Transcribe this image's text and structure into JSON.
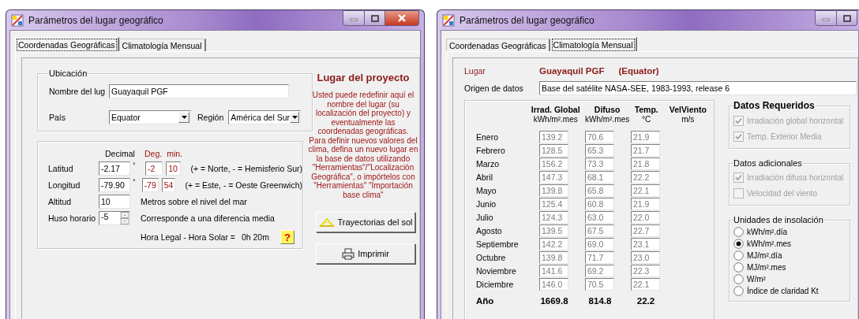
{
  "windows": [
    {
      "kind": "coordinates",
      "title": "Parámetros del lugar geográfico",
      "tabs": [
        {
          "label": "Coordenadas Geográficas",
          "selected": true
        },
        {
          "label": "Climatología Mensual",
          "selected": false
        }
      ],
      "location": {
        "legend": "Ubicación",
        "name_label": "Nombre del lug",
        "name_value": "Guayaquil PGF",
        "country_label": "País",
        "country_value": "Equator",
        "region_label": "Región",
        "region_value": "América del Sur"
      },
      "coordinates": {
        "headers": {
          "decimal": "Decimal",
          "degrees": "Deg.",
          "minutes": "min."
        },
        "rows": [
          {
            "label": "Latitud",
            "decimal": "-2.17",
            "unit": "°",
            "degrees": "-2",
            "minutes": "10",
            "note": "(+ = Norte, - = Hemisferio Sur)"
          },
          {
            "label": "Longitud",
            "decimal": "-79.90",
            "unit": "°",
            "degrees": "-79",
            "minutes": "54",
            "note": "(+ = Este, - = Oeste Greenwich)"
          }
        ],
        "altitude": {
          "label": "Altitud",
          "value": "10",
          "note": "Metros sobre el nivel del mar"
        },
        "timezone": {
          "label": "Huso horario",
          "value": "-5",
          "note": "Corresponde a una diferencia media"
        },
        "time_difference": {
          "label": "Hora Legal - Hora Solar =",
          "value": "0h 20m"
        },
        "help_button": "?"
      },
      "info": {
        "title": "Lugar del proyecto",
        "paragraphs": [
          "Usted puede redefinir aquí el nombre del lugar (su localización del proyecto) y eventualmente las coordenadas geográficas.",
          "Para definir nuevos valores del clima, defina un nuevo lugar en la base de datos utilizando \"Herramientas\"/\"Localización Geográfica\", o impórtelos con \"Herramientas\" \"Importación base clima\""
        ]
      },
      "buttons": [
        {
          "label": "Trayectorias del sol"
        },
        {
          "label": "Imprimir"
        }
      ]
    },
    {
      "kind": "climate",
      "title": "Parámetros del lugar geográfico",
      "tabs": [
        {
          "label": "Coordenadas Geográficas",
          "selected": false
        },
        {
          "label": "Climatología Mensual",
          "selected": true
        }
      ],
      "place": {
        "label": "Lugar",
        "name": "Guayaquil PGF",
        "country": "(Equator)"
      },
      "source": {
        "label": "Origen de datos",
        "value": "Base del satélite NASA-SEE,  1983-1993, release 6"
      },
      "table": {
        "columns": [
          {
            "title": "Irrad. Global",
            "unit": "kWh/m².mes"
          },
          {
            "title": "Difuso",
            "unit": "kWh/m².mes"
          },
          {
            "title": "Temp.",
            "unit": "°C"
          },
          {
            "title": "VelViento",
            "unit": "m/s"
          }
        ],
        "rows": [
          {
            "month": "Enero",
            "values": [
              "139.2",
              "70.6",
              "21.9"
            ]
          },
          {
            "month": "Febrero",
            "values": [
              "128.5",
              "65.3",
              "21.7"
            ]
          },
          {
            "month": "Marzo",
            "values": [
              "156.2",
              "73.3",
              "21.8"
            ]
          },
          {
            "month": "Abril",
            "values": [
              "147.3",
              "68.1",
              "22.2"
            ]
          },
          {
            "month": "Mayo",
            "values": [
              "139.8",
              "65.8",
              "22.1"
            ]
          },
          {
            "month": "Junio",
            "values": [
              "125.4",
              "60.8",
              "21.9"
            ]
          },
          {
            "month": "Julio",
            "values": [
              "124.3",
              "63.0",
              "22.0"
            ]
          },
          {
            "month": "Agosto",
            "values": [
              "139.5",
              "67.5",
              "22.7"
            ]
          },
          {
            "month": "Septiembre",
            "values": [
              "142.2",
              "69.0",
              "23.1"
            ]
          },
          {
            "month": "Octubre",
            "values": [
              "139.8",
              "71.7",
              "23.0"
            ]
          },
          {
            "month": "Noviembre",
            "values": [
              "141.6",
              "69.2",
              "22.3"
            ]
          },
          {
            "month": "Diciembre",
            "values": [
              "146.0",
              "70.5",
              "22.1"
            ]
          }
        ],
        "total": {
          "label": "Año",
          "values": [
            "1669.8",
            "814.8",
            "22.2"
          ]
        }
      },
      "groups": [
        {
          "title": "Datos Requeridos",
          "kind": "checkbox",
          "items": [
            {
              "label": "Irradiación global horizontal",
              "checked": true,
              "disabled": true
            },
            {
              "label": "Temp. Exterior Media",
              "checked": true,
              "disabled": true
            }
          ]
        },
        {
          "title": "Datos adicionales",
          "kind": "checkbox",
          "items": [
            {
              "label": "Irradiación difusa horizontal",
              "checked": true,
              "disabled": true
            },
            {
              "label": "Velocidad del viento",
              "checked": false,
              "disabled": true
            }
          ]
        },
        {
          "title": "Unidades de insolación",
          "kind": "radio",
          "items": [
            {
              "label": "kWh/m².día",
              "selected": false
            },
            {
              "label": "kWh/m².mes",
              "selected": true
            },
            {
              "label": "MJ/m².día",
              "selected": false
            },
            {
              "label": "MJ/m².mes",
              "selected": false
            },
            {
              "label": "W/m²",
              "selected": false
            },
            {
              "label": "Índice de claridad Kt",
              "selected": false
            }
          ]
        }
      ]
    }
  ]
}
